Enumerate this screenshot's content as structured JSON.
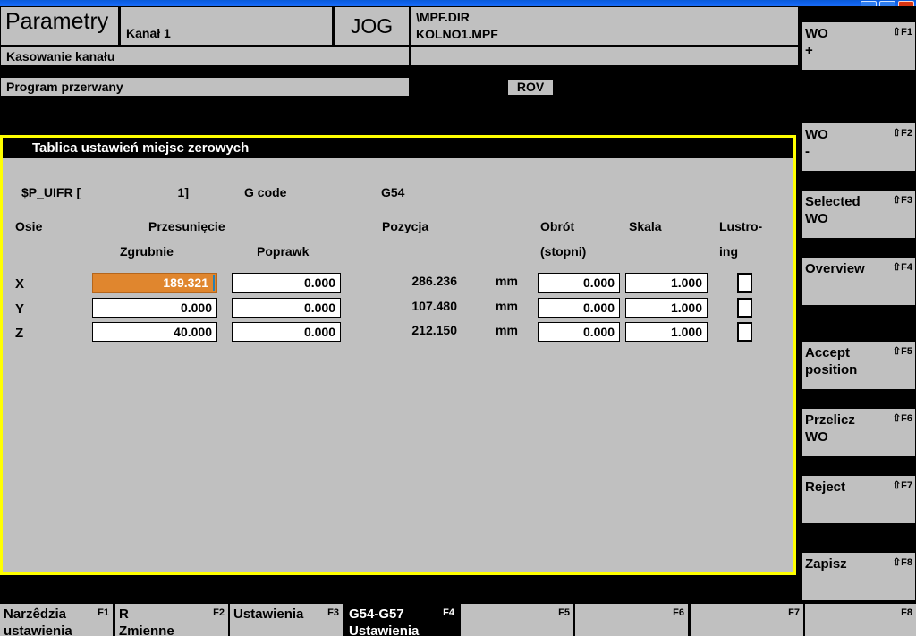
{
  "window": {
    "buttons": [
      "minimize",
      "maximize",
      "close"
    ]
  },
  "header": {
    "area_title": "Parametry",
    "channel": "Kanał 1",
    "mode": "JOG",
    "program_path": "\\MPF.DIR",
    "program_name": "KOLNO1.MPF",
    "message_1": "Kasowanie kanału",
    "message_2": "Program przerwany",
    "rov_indicator": "ROV"
  },
  "dialog": {
    "title": "Tablica ustawień miejsc zerowych",
    "frame_color": "#ffff00",
    "variable_label": "$P_UIFR  [",
    "variable_index": "1]",
    "gcode_label": "G code",
    "gcode_value": "G54",
    "columns": {
      "axes": "Osie",
      "offset": "Przesunięcie",
      "offset_coarse": "Zgrubnie",
      "offset_fine": "Poprawk",
      "position": "Pozycja",
      "rotation": "Obrót",
      "rotation_unit": "(stopni)",
      "scale": "Skala",
      "mirror_line1": "Lustro-",
      "mirror_line2": "ing"
    },
    "unit": "mm",
    "selected_color": "#e0862e",
    "rows": [
      {
        "axis": "X",
        "coarse": "189.321",
        "fine": "0.000",
        "position": "286.236",
        "unit": "mm",
        "rotation": "0.000",
        "scale": "1.000",
        "mirror": false,
        "selected_field": "coarse"
      },
      {
        "axis": "Y",
        "coarse": "0.000",
        "fine": "0.000",
        "position": "107.480",
        "unit": "mm",
        "rotation": "0.000",
        "scale": "1.000",
        "mirror": false,
        "selected_field": null
      },
      {
        "axis": "Z",
        "coarse": "40.000",
        "fine": "0.000",
        "position": "212.150",
        "unit": "mm",
        "rotation": "0.000",
        "scale": "1.000",
        "mirror": false,
        "selected_field": null
      }
    ]
  },
  "vertical_softkeys": [
    {
      "label": "WO\n+",
      "fkey": "⇧F1"
    },
    {
      "label": "WO\n-",
      "fkey": "⇧F2"
    },
    {
      "label": "Selected\nWO",
      "fkey": "⇧F3"
    },
    {
      "label": "Overview",
      "fkey": "⇧F4"
    },
    {
      "label": "Accept\nposition",
      "fkey": "⇧F5"
    },
    {
      "label": "Przelicz\nWO",
      "fkey": "⇧F6"
    },
    {
      "label": "Reject",
      "fkey": "⇧F7"
    },
    {
      "label": "Zapisz",
      "fkey": "⇧F8"
    }
  ],
  "horizontal_softkeys": [
    {
      "label": "Narzêdzia\nustawienia",
      "fkey": "F1",
      "active": false
    },
    {
      "label": "R\nZmienne",
      "fkey": "F2",
      "active": false
    },
    {
      "label": "Ustawienia",
      "fkey": "F3",
      "active": false
    },
    {
      "label": "G54-G57\nUstawienia",
      "fkey": "F4",
      "active": true
    },
    {
      "label": "",
      "fkey": "F5",
      "active": false
    },
    {
      "label": "",
      "fkey": "F6",
      "active": false
    },
    {
      "label": "",
      "fkey": "F7",
      "active": false
    },
    {
      "label": "",
      "fkey": "F8",
      "active": false
    }
  ]
}
